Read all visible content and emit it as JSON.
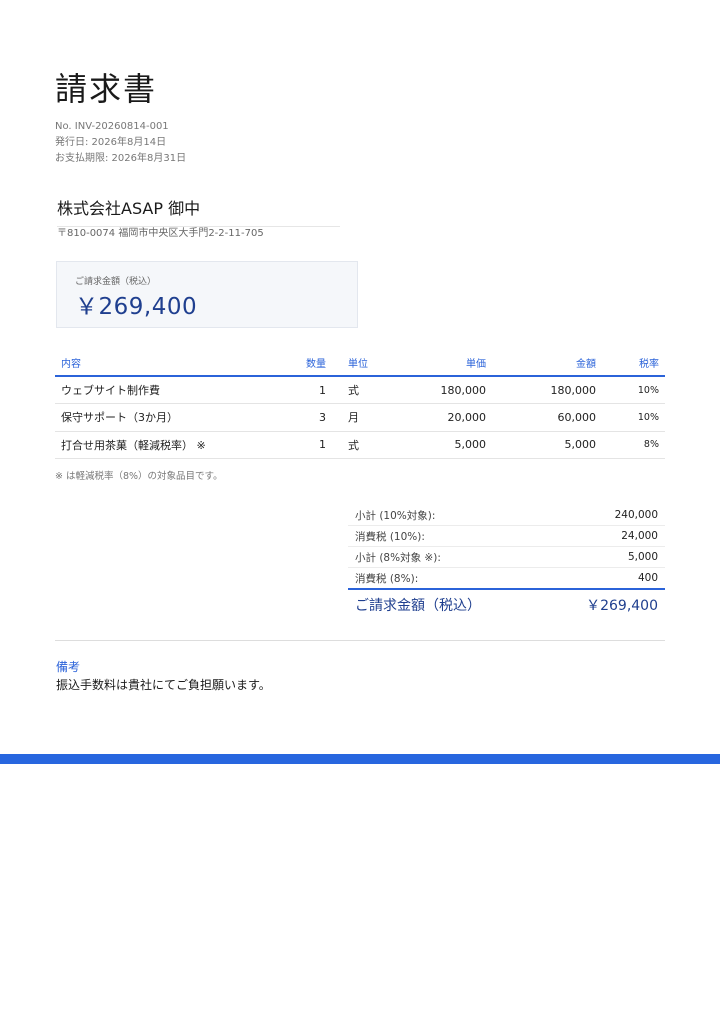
{
  "document": {
    "title": "請求書",
    "number": "No. INV-20260814-001",
    "issue_date": "発行日: 2026年8月14日",
    "due_date": "お支払期限: 2026年8月31日"
  },
  "recipient": {
    "name": "株式会社ASAP 御中",
    "address": "〒810-0074 福岡市中央区大手門2-2-11-705"
  },
  "amount_box": {
    "label": "ご請求金額（税込）",
    "value": "￥269,400"
  },
  "items_table": {
    "headers": {
      "description": "内容",
      "quantity": "数量",
      "unit": "単位",
      "unit_price": "単価",
      "amount": "金額",
      "tax_rate": "税率"
    },
    "rows": [
      {
        "description": "ウェブサイト制作費",
        "quantity": "1",
        "unit": "式",
        "unit_price": "180,000",
        "amount": "180,000",
        "tax_rate": "10%"
      },
      {
        "description": "保守サポート（3か月）",
        "quantity": "3",
        "unit": "月",
        "unit_price": "20,000",
        "amount": "60,000",
        "tax_rate": "10%"
      },
      {
        "description": "打合せ用茶菓（軽減税率） ※",
        "quantity": "1",
        "unit": "式",
        "unit_price": "5,000",
        "amount": "5,000",
        "tax_rate": "8%"
      }
    ]
  },
  "reduced_tax_note": "※ は軽減税率（8%）の対象品目です。",
  "summary": {
    "rows": [
      {
        "label": "小計 (10%対象):",
        "value": "240,000"
      },
      {
        "label": "消費税 (10%):",
        "value": "24,000"
      },
      {
        "label": "小計 (8%対象 ※):",
        "value": "5,000"
      },
      {
        "label": "消費税 (8%):",
        "value": "400"
      }
    ],
    "total_label": "ご請求金額（税込）",
    "total_value": "￥269,400"
  },
  "remarks": {
    "label": "備考",
    "text": "振込手数料は貴社にてご負担願います。"
  },
  "colors": {
    "accent": "#2b63d9",
    "total_text": "#1f3f8f",
    "bottom_bar": "#2766df"
  }
}
